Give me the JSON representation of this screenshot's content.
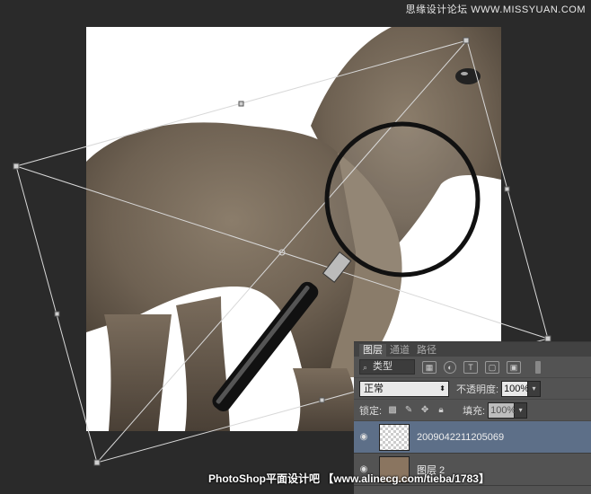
{
  "watermark_top": "思缘设计论坛 WWW.MISSYUAN.COM",
  "footer_banner": "PhotoShop平面设计吧 【www.alinecg.com/tieba/1783】",
  "layers_panel": {
    "tabs": [
      "图层",
      "通道",
      "路径"
    ],
    "active_tab": 0,
    "filter_kind": "类型",
    "blend_mode": "正常",
    "opacity_label": "不透明度:",
    "opacity_value": "100%",
    "lock_label": "锁定:",
    "fill_label": "填充:",
    "fill_value": "100%",
    "layers": [
      {
        "name": "2009042211205069",
        "selected": true,
        "visible": true
      },
      {
        "name": "图层 2",
        "selected": false,
        "visible": true
      }
    ]
  },
  "colors": {
    "background": "#2a2a2a",
    "panel": "#535353",
    "selected_layer": "#5d6f88",
    "donkey_fur": "#7a6c5c"
  },
  "icons": {
    "eye": "eye-icon",
    "search": "search-icon",
    "lock": "lock-icon",
    "move": "move-icon",
    "brush": "brush-icon"
  }
}
